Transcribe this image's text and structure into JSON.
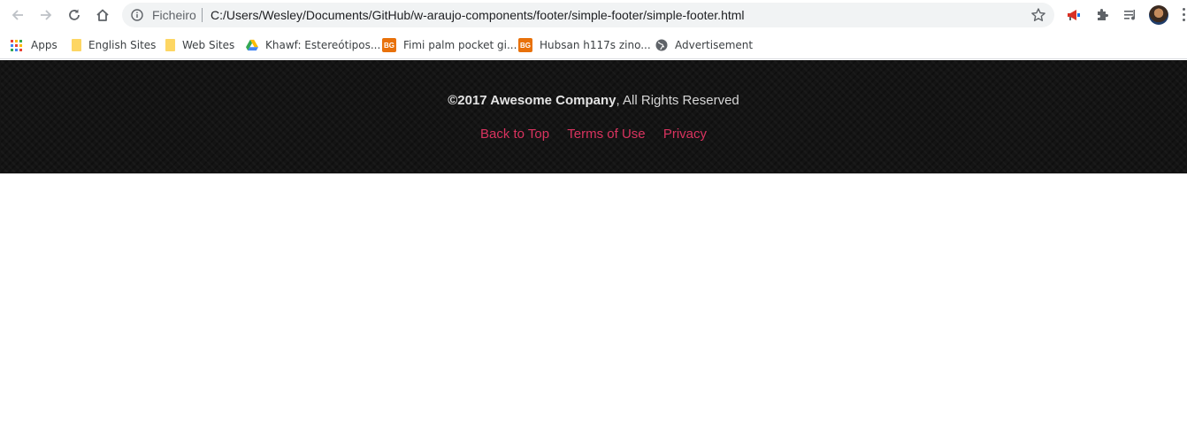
{
  "browser": {
    "omnibox": {
      "scheme_label": "Ficheiro",
      "url": "C:/Users/Wesley/Documents/GitHub/w-araujo-components/footer/simple-footer/simple-footer.html"
    },
    "icons": [
      "back-icon",
      "forward-icon",
      "reload-icon",
      "home-icon",
      "info-icon",
      "star-icon",
      "megaphone-extension-icon",
      "puzzle-extensions-icon",
      "media-queue-icon",
      "profile-avatar",
      "menu-kebab-icon"
    ]
  },
  "bookmarks": [
    {
      "label": "Apps",
      "icon": "apps-grid-icon"
    },
    {
      "label": "English Sites",
      "icon": "folder-icon"
    },
    {
      "label": "Web Sites",
      "icon": "folder-icon"
    },
    {
      "label": "Khawf: Estereótipos...",
      "icon": "google-drive-icon"
    },
    {
      "label": "Fimi palm pocket gi...",
      "icon": "banggood-icon",
      "badge": "BG"
    },
    {
      "label": "Hubsan h117s zino...",
      "icon": "banggood-icon",
      "badge": "BG"
    },
    {
      "label": "Advertisement",
      "icon": "globe-icon"
    }
  ],
  "footer": {
    "company": "©2017 Awesome Company",
    "rights": ", All Rights Reserved",
    "links": [
      "Back to Top",
      "Terms of Use",
      "Privacy"
    ]
  },
  "colors": {
    "footer_bg": "#141414",
    "link": "#d9335f",
    "text": "#d6d6d6"
  }
}
